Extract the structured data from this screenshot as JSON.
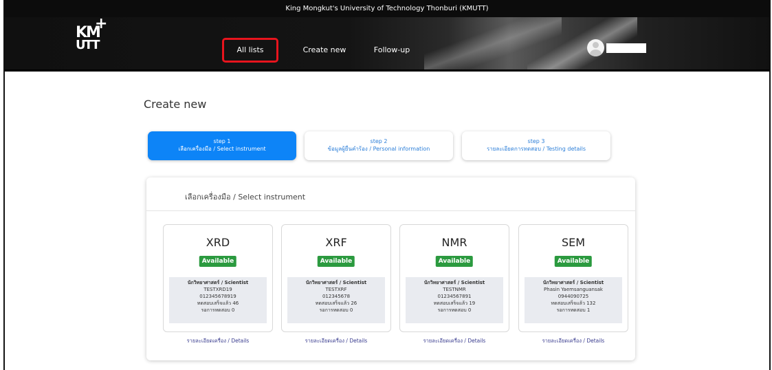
{
  "topbar": {
    "title": "King Mongkut's University of Technology Thonburi (KMUTT)"
  },
  "logo": {
    "km": "KM",
    "utt": "UTT",
    "plus": "+"
  },
  "nav": {
    "all_lists": "All lists",
    "create_new": "Create new",
    "follow_up": "Follow-up"
  },
  "page": {
    "title": "Create new"
  },
  "steps": [
    {
      "number": "step 1",
      "label": "เลือกเครื่องมือ / Select instrument"
    },
    {
      "number": "step 2",
      "label": "ข้อมูลผู้ยื่นคำร้อง / Personal information"
    },
    {
      "number": "step 3",
      "label": "รายละเอียดการทดสอบ / Testing details"
    }
  ],
  "panel": {
    "title": "เลือกเครื่องมือ / Select instrument"
  },
  "instruments": [
    {
      "name": "XRD",
      "status": "Available",
      "role": "นักวิทยาศาสตร์ / Scientist",
      "scientist": "TESTXRD19",
      "phone": "012345678919",
      "tested": "ทดสอบเสร็จแล้ว 46",
      "waiting": "รอการทดสอบ 0",
      "details": "รายละเอียดเครื่อง / Details"
    },
    {
      "name": "XRF",
      "status": "Available",
      "role": "นักวิทยาศาสตร์ / Scientist",
      "scientist": "TESTXRF",
      "phone": "012345678",
      "tested": "ทดสอบเสร็จแล้ว 26",
      "waiting": "รอการทดสอบ 0",
      "details": "รายละเอียดเครื่อง / Details"
    },
    {
      "name": "NMR",
      "status": "Available",
      "role": "นักวิทยาศาสตร์ / Scientist",
      "scientist": "TESTNMR",
      "phone": "01234567891",
      "tested": "ทดสอบเสร็จแล้ว 19",
      "waiting": "รอการทดสอบ 0",
      "details": "รายละเอียดเครื่อง / Details"
    },
    {
      "name": "SEM",
      "status": "Available",
      "role": "นักวิทยาศาสตร์ / Scientist",
      "scientist": "Phasin Yaemsanguansak",
      "phone": "0944090725",
      "tested": "ทดสอบเสร็จแล้ว 132",
      "waiting": "รอการทดสอบ 1",
      "details": "รายละเอียดเครื่อง / Details"
    }
  ],
  "colors": {
    "primary": "#0d84f7",
    "available": "#2b9a3f",
    "highlight": "#e8141d",
    "link": "#3a3d8f"
  }
}
